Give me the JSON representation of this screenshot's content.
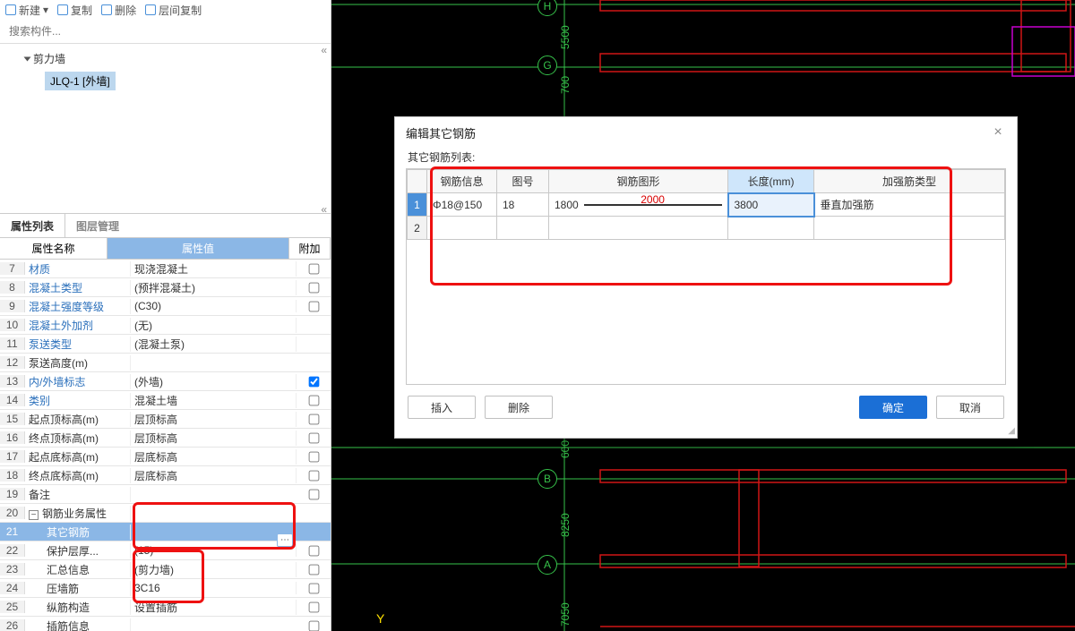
{
  "toolbar": {
    "items": [
      "新建",
      "复制",
      "删除",
      "层间复制"
    ]
  },
  "search": {
    "placeholder": "搜索构件..."
  },
  "tree": {
    "root": "剪力墙",
    "child": "JLQ-1 [外墙]"
  },
  "propTabs": {
    "active": "属性列表",
    "other": "图层管理"
  },
  "propHeader": {
    "name": "属性名称",
    "value": "属性值",
    "extra": "附加"
  },
  "propRows": [
    {
      "n": 7,
      "name": "材质",
      "val": "现浇混凝土",
      "blue": true,
      "chk": false
    },
    {
      "n": 8,
      "name": "混凝土类型",
      "val": "(预拌混凝土)",
      "blue": true,
      "chk": false
    },
    {
      "n": 9,
      "name": "混凝土强度等级",
      "val": "(C30)",
      "blue": true,
      "chk": false
    },
    {
      "n": 10,
      "name": "混凝土外加剂",
      "val": "(无)",
      "blue": true
    },
    {
      "n": 11,
      "name": "泵送类型",
      "val": "(混凝土泵)",
      "blue": true
    },
    {
      "n": 12,
      "name": "泵送高度(m)",
      "val": "",
      "blue": false
    },
    {
      "n": 13,
      "name": "内/外墙标志",
      "val": "(外墙)",
      "blue": true,
      "chk": true
    },
    {
      "n": 14,
      "name": "类别",
      "val": "混凝土墙",
      "blue": true,
      "chk": false
    },
    {
      "n": 15,
      "name": "起点顶标高(m)",
      "val": "层顶标高",
      "blue": false,
      "chk": false
    },
    {
      "n": 16,
      "name": "终点顶标高(m)",
      "val": "层顶标高",
      "blue": false,
      "chk": false
    },
    {
      "n": 17,
      "name": "起点底标高(m)",
      "val": "层底标高",
      "blue": false,
      "chk": false
    },
    {
      "n": 18,
      "name": "终点底标高(m)",
      "val": "层底标高",
      "blue": false,
      "chk": false
    },
    {
      "n": 19,
      "name": "备注",
      "val": "",
      "blue": false,
      "chk": false
    },
    {
      "n": 20,
      "name": "钢筋业务属性",
      "val": "",
      "group": true
    },
    {
      "n": 21,
      "name": "其它钢筋",
      "val": "",
      "indent": true,
      "hl": true,
      "ellipsis": true
    },
    {
      "n": 22,
      "name": "保护层厚...",
      "val": "(15)",
      "indent": true,
      "chk": false
    },
    {
      "n": 23,
      "name": "汇总信息",
      "val": "(剪力墙)",
      "indent": true,
      "chk": false
    },
    {
      "n": 24,
      "name": "压墙筋",
      "val": "3C16",
      "indent": true,
      "chk": false
    },
    {
      "n": 25,
      "name": "纵筋构造",
      "val": "设置插筋",
      "indent": true,
      "chk": false
    },
    {
      "n": 26,
      "name": "插筋信息",
      "val": "",
      "indent": true,
      "chk": false
    }
  ],
  "canvas": {
    "axes": [
      "H",
      "G",
      "B",
      "A"
    ],
    "dims": [
      "5500",
      "700",
      "600",
      "8250",
      "7050"
    ],
    "ylabel": "Y"
  },
  "dialog": {
    "title": "编辑其它钢筋",
    "subtitle": "其它钢筋列表:",
    "cols": {
      "c0": "",
      "c1": "钢筋信息",
      "c2": "图号",
      "c3": "钢筋图形",
      "c4": "长度(mm)",
      "c5": "加强筋类型"
    },
    "row1": {
      "info": "Φ18@150",
      "num": "18",
      "shape_a": "1800",
      "shape_b": "2000",
      "len": "3800",
      "type": "垂直加强筋"
    },
    "btns": {
      "insert": "插入",
      "delete": "删除",
      "ok": "确定",
      "cancel": "取消"
    }
  }
}
